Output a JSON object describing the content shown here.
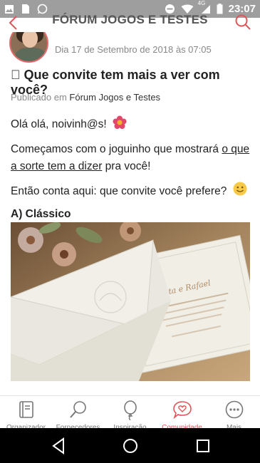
{
  "status_bar": {
    "time": "23:07",
    "network": "4G",
    "left_icons": [
      "image-icon",
      "sim-icon",
      "whatsapp-icon"
    ],
    "right_icons": [
      "dnd-icon",
      "wifi-icon",
      "signal-icon",
      "battery-icon"
    ]
  },
  "header": {
    "title": "FÓRUM JOGOS E TESTES",
    "back_icon": "chevron-left-icon",
    "search_icon": "search-icon",
    "accent_color": "#e0555a"
  },
  "post": {
    "date": "Dia 17 de Setembro de 2018 às 07:05",
    "title": "\u0000 Que convite tem mais a ver com você?",
    "published_prefix": "Publicado em",
    "published_forum": "Fórum Jogos e Testes",
    "greeting": "Olá olá, noivinh@s!",
    "intro_start": "Começamos com o joguinho que mostrará ",
    "intro_link": "o que a sorte tem a dizer",
    "intro_end": " pra você!",
    "question": "Então conta aqui: que convite você prefere?",
    "option_a": "A) Clássico",
    "image_text_names": "Renata e Rafael"
  },
  "bottom_nav": {
    "items": [
      {
        "label": "Organizador",
        "icon": "notebook-icon"
      },
      {
        "label": "Fornecedores",
        "icon": "search-icon"
      },
      {
        "label": "Inspiração",
        "icon": "balloon-icon"
      },
      {
        "label": "Comunidade",
        "icon": "chat-heart-icon",
        "active": true
      },
      {
        "label": "Mais",
        "icon": "more-icon"
      }
    ]
  },
  "system_nav": {
    "icons": [
      "back-triangle-icon",
      "home-circle-icon",
      "recents-square-icon"
    ]
  }
}
